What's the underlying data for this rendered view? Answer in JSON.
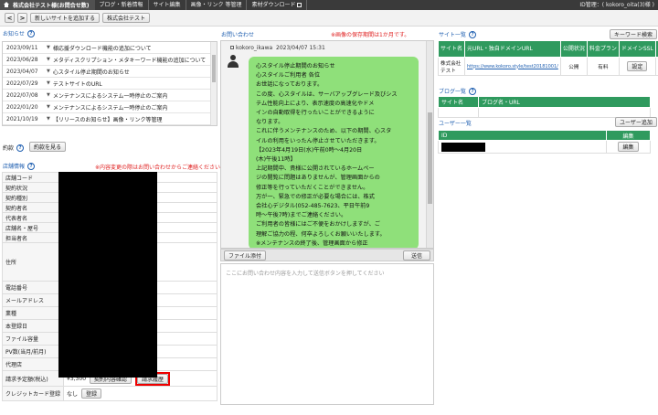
{
  "topbar": {
    "company": "株式会社テスト様(お問合せ数)",
    "menu": [
      "ブログ・新着情報",
      "サイト編集",
      "画像・リンク 等管理",
      "素材ダウンロード"
    ],
    "user": "ID管理：( kokoro_oita(3)様 )"
  },
  "subbar": {
    "back": "<",
    "forward": ">",
    "new_site": "新しいサイトを追加する",
    "company_button": "株式会社テスト"
  },
  "news": {
    "title": "お知らせ",
    "items": [
      {
        "date": "2023/09/11",
        "text": "様応援ダウンロード機能の追加について"
      },
      {
        "date": "2023/06/28",
        "text": "メタディスクリプション・メタキーワード機能の追加について"
      },
      {
        "date": "2023/04/07",
        "text": "心スタイル停止期間のお知らせ"
      },
      {
        "date": "2022/07/29",
        "text": "テストサイトのURL"
      },
      {
        "date": "2022/07/08",
        "text": "メンテナンスによるシステム一時停止のご案内"
      },
      {
        "date": "2022/01/20",
        "text": "メンテナンスによるシステム一時停止のご案内"
      },
      {
        "date": "2021/10/19",
        "text": "【リリースのお知らせ】画像・リンク等管理"
      }
    ]
  },
  "contract": {
    "title": "約款",
    "button": "約款を見る"
  },
  "store": {
    "title": "店舗情報",
    "notice": "※内容変更の際はお問い合わせからご連絡ください。",
    "fields": [
      "店舗コード",
      "契約状況",
      "契約種別",
      "契約者名",
      "代表者名",
      "店舗名・屋号",
      "担当者名",
      "住所",
      "電話番号",
      "メールアドレス",
      "業種",
      "本登録日",
      "ファイル容量",
      "PV数(当月/前月)",
      "代理店",
      "請求予定額(税込)",
      "クレジットカード登録"
    ],
    "billing_amount": "¥3,300",
    "billing_confirm": "契約内容確認",
    "billing_history": "請求履歴",
    "card_status": "なし",
    "card_button": "登録"
  },
  "chat": {
    "title": "お問い合わせ",
    "notice": "※画像の保存期間は1か月です。",
    "sender": "kokoro_ikawa",
    "timestamp": "2023/04/07 15:31",
    "message_lines": [
      "心スタイル停止期間のお知らせ",
      "",
      "心スタイルご利用者 各位",
      "お世話になっております。",
      "この度、心スタイルは、サーバアップグレード及びシス",
      "テム性能向上により、表示速度の高速化やドメ",
      "インの自動取得を行ったいことができるように",
      "なります。",
      "これに伴うメンテナンスのため、以下の期間、心スタ",
      "イルの利用をいったん停止させていただきます。",
      "【2023年4月19日(水)午前0時～4月20日",
      "(木)午後11時】",
      "上記期間中、貴様に公開されているホームペー",
      "ジの閲覧に問題はありませんが、管理画面からの",
      "修正等を行っていただくことができません。",
      "万が一、緊急での修正が必要な場合には、株式",
      "会社心デジタル(052-485-7623、平日午前9",
      "時～午後7時)までご連絡ください。",
      "ご利用者の皆様にはご不便をおかけしますが、ご",
      "理解ご協力の程、何卒よろしくお願いいたします。",
      "※メンテナンスの終了後、管理画面から修正"
    ],
    "attach_button": "ファイル添付",
    "send_button": "送信",
    "reply_placeholder": "ここにお問い合わせ内容を入力して送信ボタンを押してください"
  },
  "sites": {
    "title": "サイト一覧",
    "keyword_button": "キーワード検索",
    "headers": [
      "サイト名",
      "元URL・独自ドメインURL",
      "公開状況",
      "料金プラン",
      "ドメインSSL",
      "編集"
    ],
    "row": {
      "name": "株式会社テスト",
      "url": "https://www.kokoro.style/test20181001/",
      "status": "公開",
      "plan": "有料",
      "ssl_button": "設定",
      "edit_button": "編集"
    }
  },
  "blog": {
    "title": "ブログ一覧",
    "headers": [
      "サイト名",
      "ブログ名・URL"
    ]
  },
  "users": {
    "title": "ユーザー一覧",
    "add_button": "ユーザー追加",
    "headers": [
      "ID",
      "編集"
    ],
    "edit_button": "編集"
  },
  "colors": {
    "accent_green": "#2f9a5e",
    "bubble_green": "#8fe07a",
    "link_blue": "#1f5fb0",
    "warning_red": "#e02020"
  }
}
